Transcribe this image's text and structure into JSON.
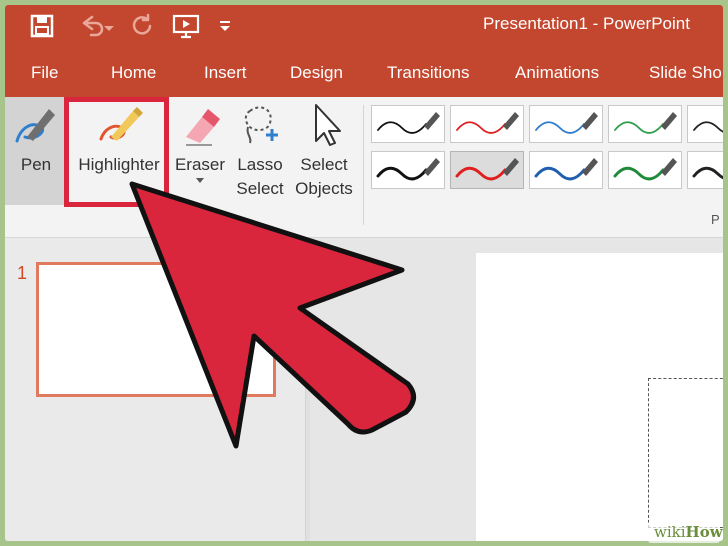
{
  "window": {
    "title": "Presentation1 - PowerPoint"
  },
  "quick_access": {
    "icons": [
      "save-icon",
      "undo-icon",
      "dropdown-caret-icon",
      "redo-icon",
      "present-from-start-icon",
      "customize-toolbar-icon"
    ]
  },
  "tabs": [
    {
      "label": "File"
    },
    {
      "label": "Home"
    },
    {
      "label": "Insert"
    },
    {
      "label": "Design"
    },
    {
      "label": "Transitions"
    },
    {
      "label": "Animations"
    },
    {
      "label": "Slide Sho"
    }
  ],
  "ribbon": {
    "tools": {
      "pen": "Pen",
      "highlighter": "Highlighter",
      "eraser": "Eraser",
      "lasso_1": "Lasso",
      "lasso_2": "Select",
      "select_1": "Select",
      "select_2": "Objects"
    },
    "group_label": "P",
    "pen_gallery": {
      "row1_colors": [
        "#111111",
        "#e02020",
        "#2e7bcf",
        "#2e9e4a",
        "#222222"
      ],
      "row2_colors": [
        "#111111",
        "#e02020",
        "#1f5fae",
        "#1e8a3a",
        "#222222"
      ],
      "selected": "row2-2"
    }
  },
  "thumbnails": {
    "slide_number": "1"
  },
  "watermark": {
    "prefix": "wiki",
    "suffix": "How"
  },
  "colors": {
    "accent": "#c3472f",
    "highlight_frame": "#d9263c",
    "arrow": "#d9263c"
  }
}
